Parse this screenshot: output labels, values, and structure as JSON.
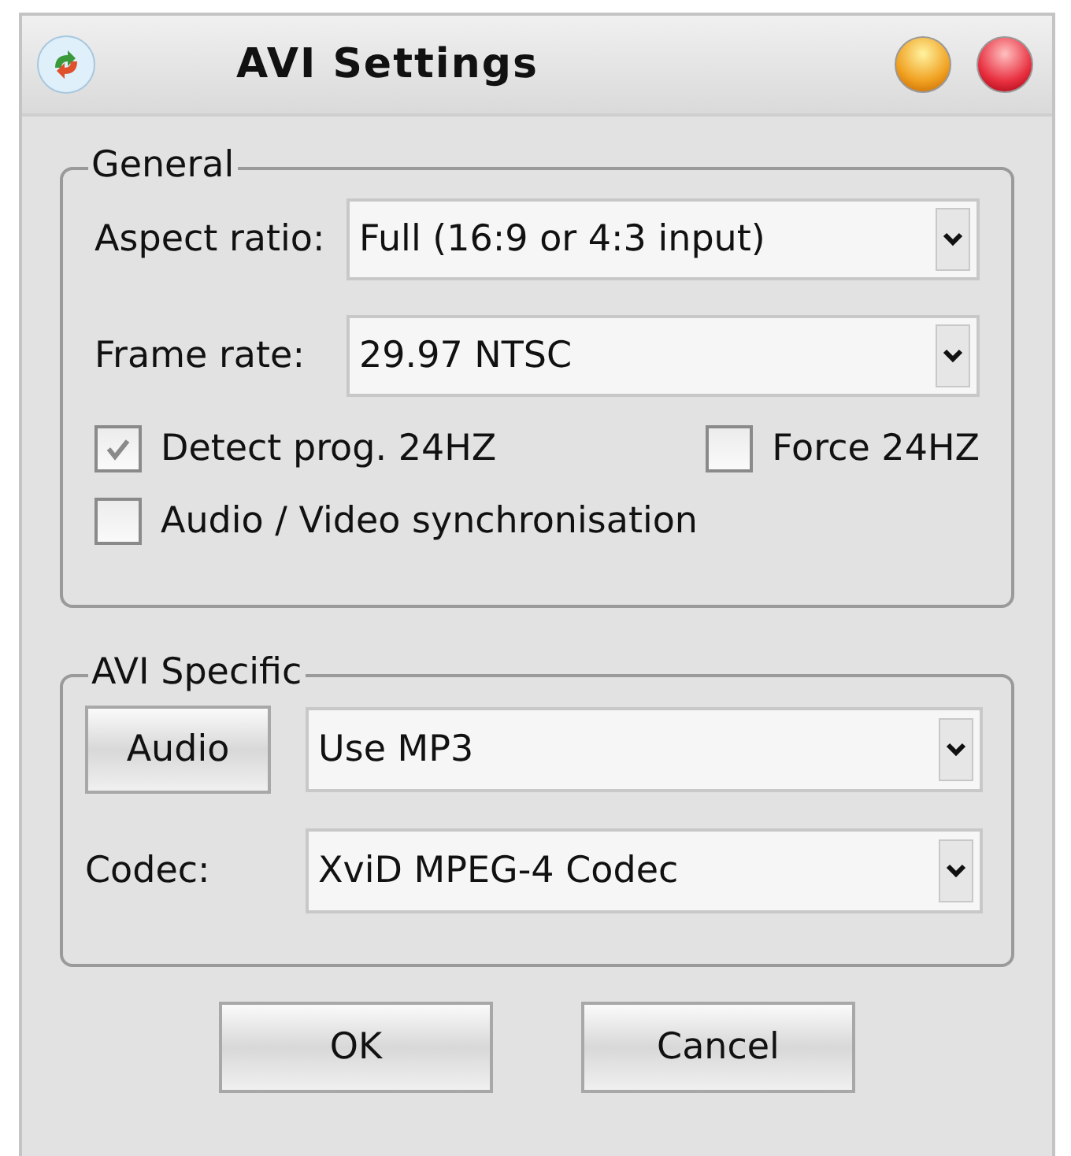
{
  "window": {
    "title": "AVI Settings"
  },
  "general": {
    "title": "General",
    "fields": [
      {
        "label": "Aspect ratio:",
        "value": "Full (16:9 or 4:3 input)"
      },
      {
        "label": "Frame rate:",
        "value": "29.97 NTSC"
      }
    ],
    "checkboxes": [
      {
        "label": "Detect prog. 24HZ",
        "checked": true
      },
      {
        "label": "Force 24HZ",
        "checked": false
      },
      {
        "label": "Audio / Video synchronisation",
        "checked": false
      }
    ]
  },
  "avi_specific": {
    "title": "AVI Specific",
    "audio_button": "Audio",
    "audio_value": "Use MP3",
    "codec_label": "Codec:",
    "codec_value": "XviD MPEG-4 Codec"
  },
  "buttons": [
    "OK",
    "Cancel"
  ]
}
